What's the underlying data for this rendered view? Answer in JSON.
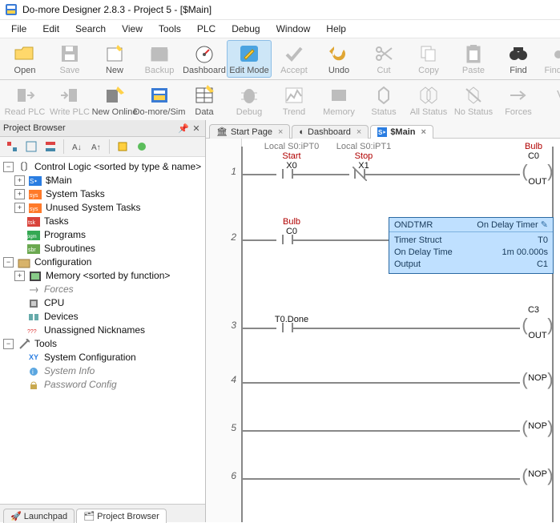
{
  "window": {
    "title": "Do-more Designer 2.8.3 - Project 5 - [$Main]"
  },
  "menu": {
    "items": [
      "File",
      "Edit",
      "Search",
      "View",
      "Tools",
      "PLC",
      "Debug",
      "Window",
      "Help"
    ]
  },
  "toolbar1": {
    "buttons": [
      {
        "label": "Open",
        "icon": "folder-open-icon",
        "enabled": true
      },
      {
        "label": "Save",
        "icon": "floppy-icon",
        "enabled": false
      },
      {
        "label": "New",
        "icon": "new-project-icon",
        "enabled": true
      },
      {
        "label": "Backup",
        "icon": "archive-icon",
        "enabled": false
      },
      {
        "label": "Dashboard",
        "icon": "gauge-icon",
        "enabled": true
      },
      {
        "label": "Edit Mode",
        "icon": "edit-mode-icon",
        "enabled": true,
        "active": true
      },
      {
        "label": "Accept",
        "icon": "accept-icon",
        "enabled": false
      },
      {
        "label": "Undo",
        "icon": "undo-icon",
        "enabled": true
      },
      {
        "label": "Cut",
        "icon": "scissors-icon",
        "enabled": false
      },
      {
        "label": "Copy",
        "icon": "copy-icon",
        "enabled": false
      },
      {
        "label": "Paste",
        "icon": "paste-icon",
        "enabled": false
      },
      {
        "label": "Find",
        "icon": "binoculars-icon",
        "enabled": true
      },
      {
        "label": "Find Next",
        "icon": "binoculars-next-icon",
        "enabled": false
      }
    ]
  },
  "toolbar2": {
    "buttons": [
      {
        "label": "Read PLC",
        "icon": "read-plc-icon",
        "enabled": false
      },
      {
        "label": "Write PLC",
        "icon": "write-plc-icon",
        "enabled": false
      },
      {
        "label": "New Online",
        "icon": "new-online-icon",
        "enabled": true
      },
      {
        "label": "Do-more/Sim",
        "icon": "sim-icon",
        "enabled": true
      },
      {
        "label": "Data",
        "icon": "data-view-icon",
        "enabled": true
      },
      {
        "label": "Debug",
        "icon": "debug-icon",
        "enabled": false
      },
      {
        "label": "Trend",
        "icon": "trend-icon",
        "enabled": false
      },
      {
        "label": "Memory",
        "icon": "memory-icon",
        "enabled": false
      },
      {
        "label": "Status",
        "icon": "status-icon",
        "enabled": false
      },
      {
        "label": "All Status",
        "icon": "all-status-icon",
        "enabled": false
      },
      {
        "label": "No Status",
        "icon": "no-status-icon",
        "enabled": false
      },
      {
        "label": "Forces",
        "icon": "forces-icon",
        "enabled": false
      },
      {
        "label": "V",
        "icon": "value-icon",
        "enabled": false
      }
    ]
  },
  "browser": {
    "title": "Project Browser",
    "root": "Control Logic <sorted by type & name>",
    "items": {
      "main": "$Main",
      "sys_tasks": "System Tasks",
      "unused_sys_tasks": "Unused System Tasks",
      "tasks": "Tasks",
      "programs": "Programs",
      "subroutines": "Subroutines"
    },
    "config": "Configuration",
    "config_items": {
      "memory": "Memory <sorted by function>",
      "forces": "Forces",
      "cpu": "CPU",
      "devices": "Devices",
      "nicknames": "Unassigned Nicknames"
    },
    "tools": "Tools",
    "tool_items": {
      "sys_config": "System Configuration",
      "sys_info": "System Info",
      "pw_config": "Password Config"
    },
    "bottom_tabs": {
      "launchpad": "Launchpad",
      "browser": "Project Browser"
    }
  },
  "doc_tabs": [
    {
      "label": "Start Page",
      "icon": "home-icon"
    },
    {
      "label": "Dashboard",
      "icon": "gauge-small-icon"
    },
    {
      "label": "$Main",
      "icon": "ladder-icon",
      "active": true
    }
  ],
  "ladder": {
    "rung1": {
      "num": "1",
      "col0_h": "Local S0:iPT0",
      "col1_h": "Local S0:iPT1",
      "c0": {
        "nick": "Start",
        "addr": "X0"
      },
      "c1": {
        "nick": "Stop",
        "addr": "X1"
      },
      "out": {
        "nick": "Bulb",
        "addr": "C0",
        "type": "OUT"
      }
    },
    "rung2": {
      "num": "2",
      "c0": {
        "nick": "Bulb",
        "addr": "C0"
      },
      "instr": {
        "name": "ONDTMR",
        "title": "On Delay Timer",
        "rows": [
          [
            "Timer Struct",
            "T0"
          ],
          [
            "On Delay Time",
            "1m 00.000s"
          ],
          [
            "Output",
            "C1"
          ]
        ]
      }
    },
    "rung3": {
      "num": "3",
      "c0": {
        "nick": "",
        "addr": "T0.Done"
      },
      "out": {
        "nick": "",
        "addr": "C3",
        "type": "OUT"
      }
    },
    "rung4": {
      "num": "4",
      "out": {
        "type": "NOP"
      }
    },
    "rung5": {
      "num": "5",
      "out": {
        "type": "NOP"
      }
    },
    "rung6": {
      "num": "6",
      "out": {
        "type": "NOP"
      }
    }
  }
}
